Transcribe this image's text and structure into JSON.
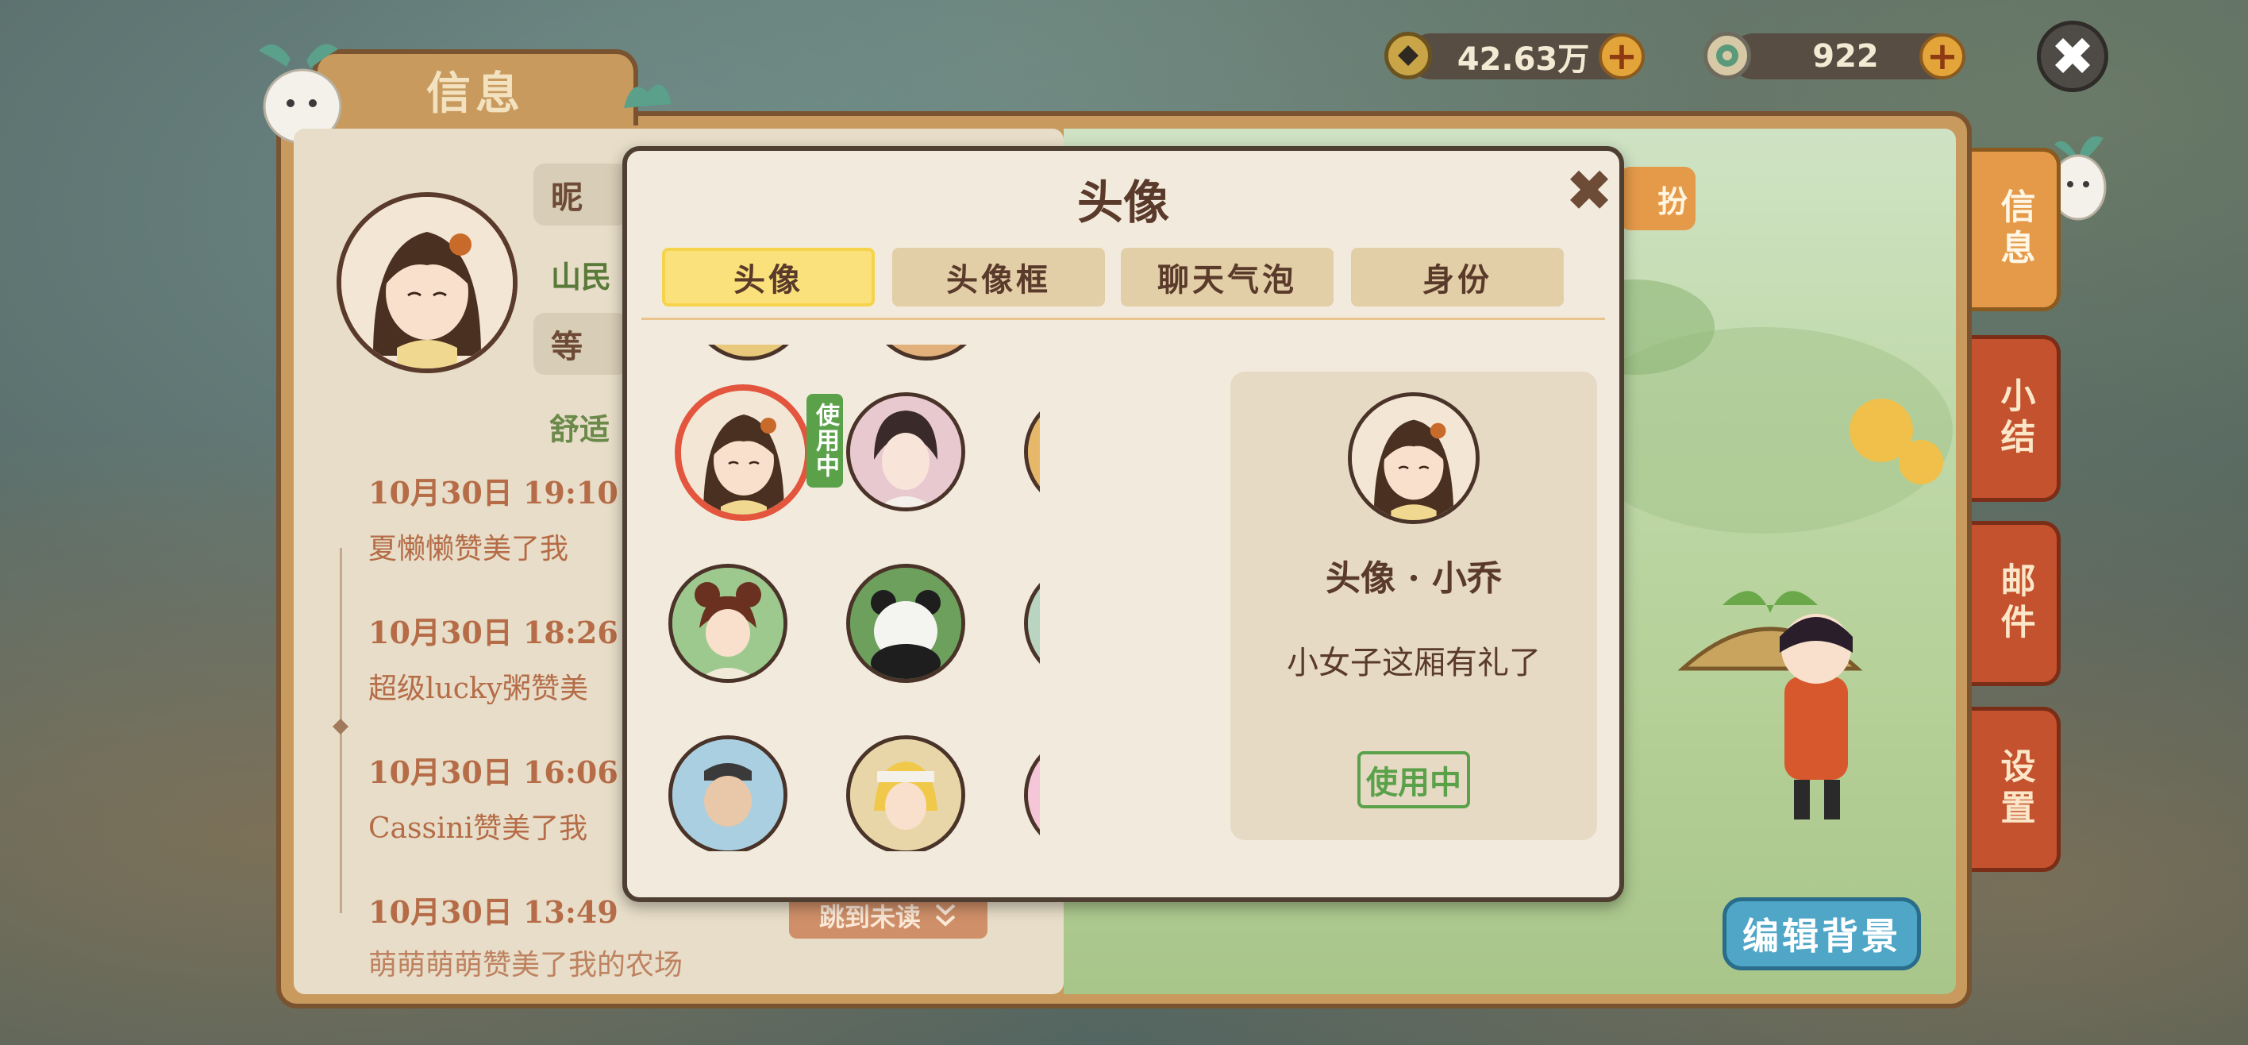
{
  "currency": {
    "coins": {
      "value": "42.63万",
      "icon": "coin-icon"
    },
    "jade": {
      "value": "922",
      "icon": "jade-coin-icon"
    },
    "add_symbol": "+"
  },
  "close_symbol": "✖",
  "window_title": "信息",
  "side_tabs": [
    {
      "label": "信息",
      "active": true
    },
    {
      "label": "小结",
      "active": false
    },
    {
      "label": "邮件",
      "active": false
    },
    {
      "label": "设置",
      "active": false
    }
  ],
  "profile": {
    "nickname_label": "昵",
    "role": "山民",
    "level_label": "等",
    "status": "舒适"
  },
  "feed": [
    {
      "date": "10月30日  19:10",
      "text": "夏懒懒赞美了我"
    },
    {
      "date": "10月30日  18:26",
      "text": "超级lucky粥赞美"
    },
    {
      "date": "10月30日  16:06",
      "text": "Cassini赞美了我"
    },
    {
      "date": "10月30日  13:49",
      "text": "萌萌萌萌赞美了我的农场"
    }
  ],
  "jump_unread": "跳到未读",
  "jump_icon": "double-chevron-down-icon",
  "dress_button": "扮",
  "edit_background": "编辑背景",
  "modal": {
    "title": "头像",
    "close": "✖",
    "tabs": [
      {
        "label": "头像",
        "active": true
      },
      {
        "label": "头像框",
        "active": false
      },
      {
        "label": "聊天气泡",
        "active": false
      },
      {
        "label": "身份",
        "active": false
      }
    ],
    "in_use_badge": "使用中",
    "avatars": [
      {
        "name": "avatar-girl-xiaoqiao",
        "selected": true,
        "in_use": true,
        "colors": [
          "#f3d5c3",
          "#5a3a2a"
        ]
      },
      {
        "name": "avatar-young-man",
        "selected": false,
        "in_use": false,
        "colors": [
          "#e9c9d0",
          "#3a2a2a"
        ]
      },
      {
        "name": "avatar-boy-warrior",
        "selected": false,
        "in_use": false,
        "colors": [
          "#e8b86a",
          "#2e2420"
        ]
      },
      {
        "name": "avatar-girl-buns",
        "selected": false,
        "in_use": false,
        "colors": [
          "#9ec98e",
          "#6a3020"
        ]
      },
      {
        "name": "avatar-panda",
        "selected": false,
        "in_use": false,
        "colors": [
          "#6da05c",
          "#1e1e1e"
        ]
      },
      {
        "name": "avatar-hooded-figure",
        "selected": false,
        "in_use": false,
        "colors": [
          "#b9d4c1",
          "#8fb09c"
        ]
      },
      {
        "name": "avatar-old-man",
        "selected": false,
        "in_use": false,
        "colors": [
          "#a9cfe0",
          "#e0c0a0"
        ]
      },
      {
        "name": "avatar-blonde-girl",
        "selected": false,
        "in_use": false,
        "colors": [
          "#e9d6a8",
          "#f0c84a"
        ]
      },
      {
        "name": "avatar-yellow-bird",
        "selected": false,
        "in_use": false,
        "colors": [
          "#f5c6d8",
          "#f4e04a"
        ]
      }
    ],
    "detail": {
      "name": "头像 · 小乔",
      "description": "小女子这厢有礼了",
      "status": "使用中"
    }
  }
}
